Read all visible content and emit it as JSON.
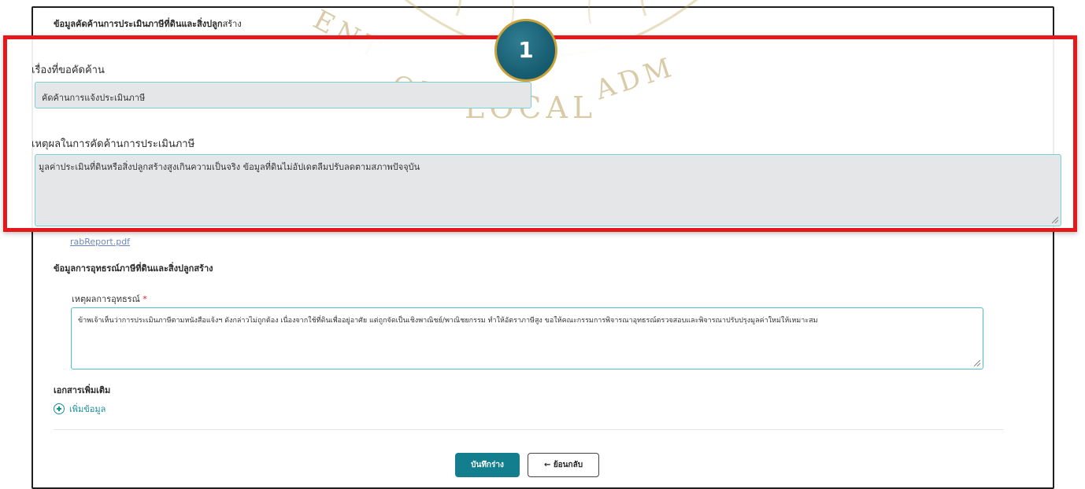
{
  "section": {
    "title_bold": "ข้อมูลคัดค้านการประเมินภาษีที่ดินและสิ่งปลูก",
    "title_light": "สร้าง"
  },
  "badge": {
    "number": "1"
  },
  "watermark": {
    "left_text": "OF",
    "right_text": "ADM",
    "middle_text": "LOCAL",
    "top_text": "ENT"
  },
  "objection": {
    "subject_label": "เรื่องที่ขอคัดค้าน",
    "subject_value": "คัดค้านการแจ้งประเมินภาษี",
    "reason_label": "เหตุผลในการคัดค้านการประเมินภาษี",
    "reason_value": "มูลค่าประเมินที่ดินหรือสิ่งปลูกสร้างสูงเกินความเป็นจริง ข้อมูลที่ดินไม่อัปเดตลืมปรับลดตามสภาพปัจจุบัน"
  },
  "file": {
    "name": "rabReport.pdf"
  },
  "appeal": {
    "section_title": "ข้อมูลการอุทธรณ์ภาษีที่ดินและสิ่งปลูกสร้าง",
    "label": "เหตุผลการอุทธรณ์",
    "required_mark": "*",
    "value": "ข้าพเจ้าเห็นว่าการประเมินภาษีตามหนังสือแจ้งฯ ดังกล่าวไม่ถูกต้อง เนื่องจากใช้ที่ดินเพื่ออยู่อาศัย แต่ถูกจัดเป็นเชิงพาณิชย์/พาณิชยกรรม ทำให้อัตราภาษีสูง ขอให้คณะกรรมการพิจารณาอุทธรณ์ตรวจสอบและพิจารณาปรับปรุงมูลค่าใหม่ให้เหมาะสม"
  },
  "extra": {
    "title": "เอกสารเพิ่มเติม",
    "add_label": "เพิ่มข้อมูล"
  },
  "actions": {
    "save_label": "บันทึกร่าง",
    "back_label": "← ย้อนกลับ"
  },
  "colors": {
    "highlight": "#e3191b",
    "primary": "#127e8e",
    "field_border": "#7ad0d2"
  }
}
